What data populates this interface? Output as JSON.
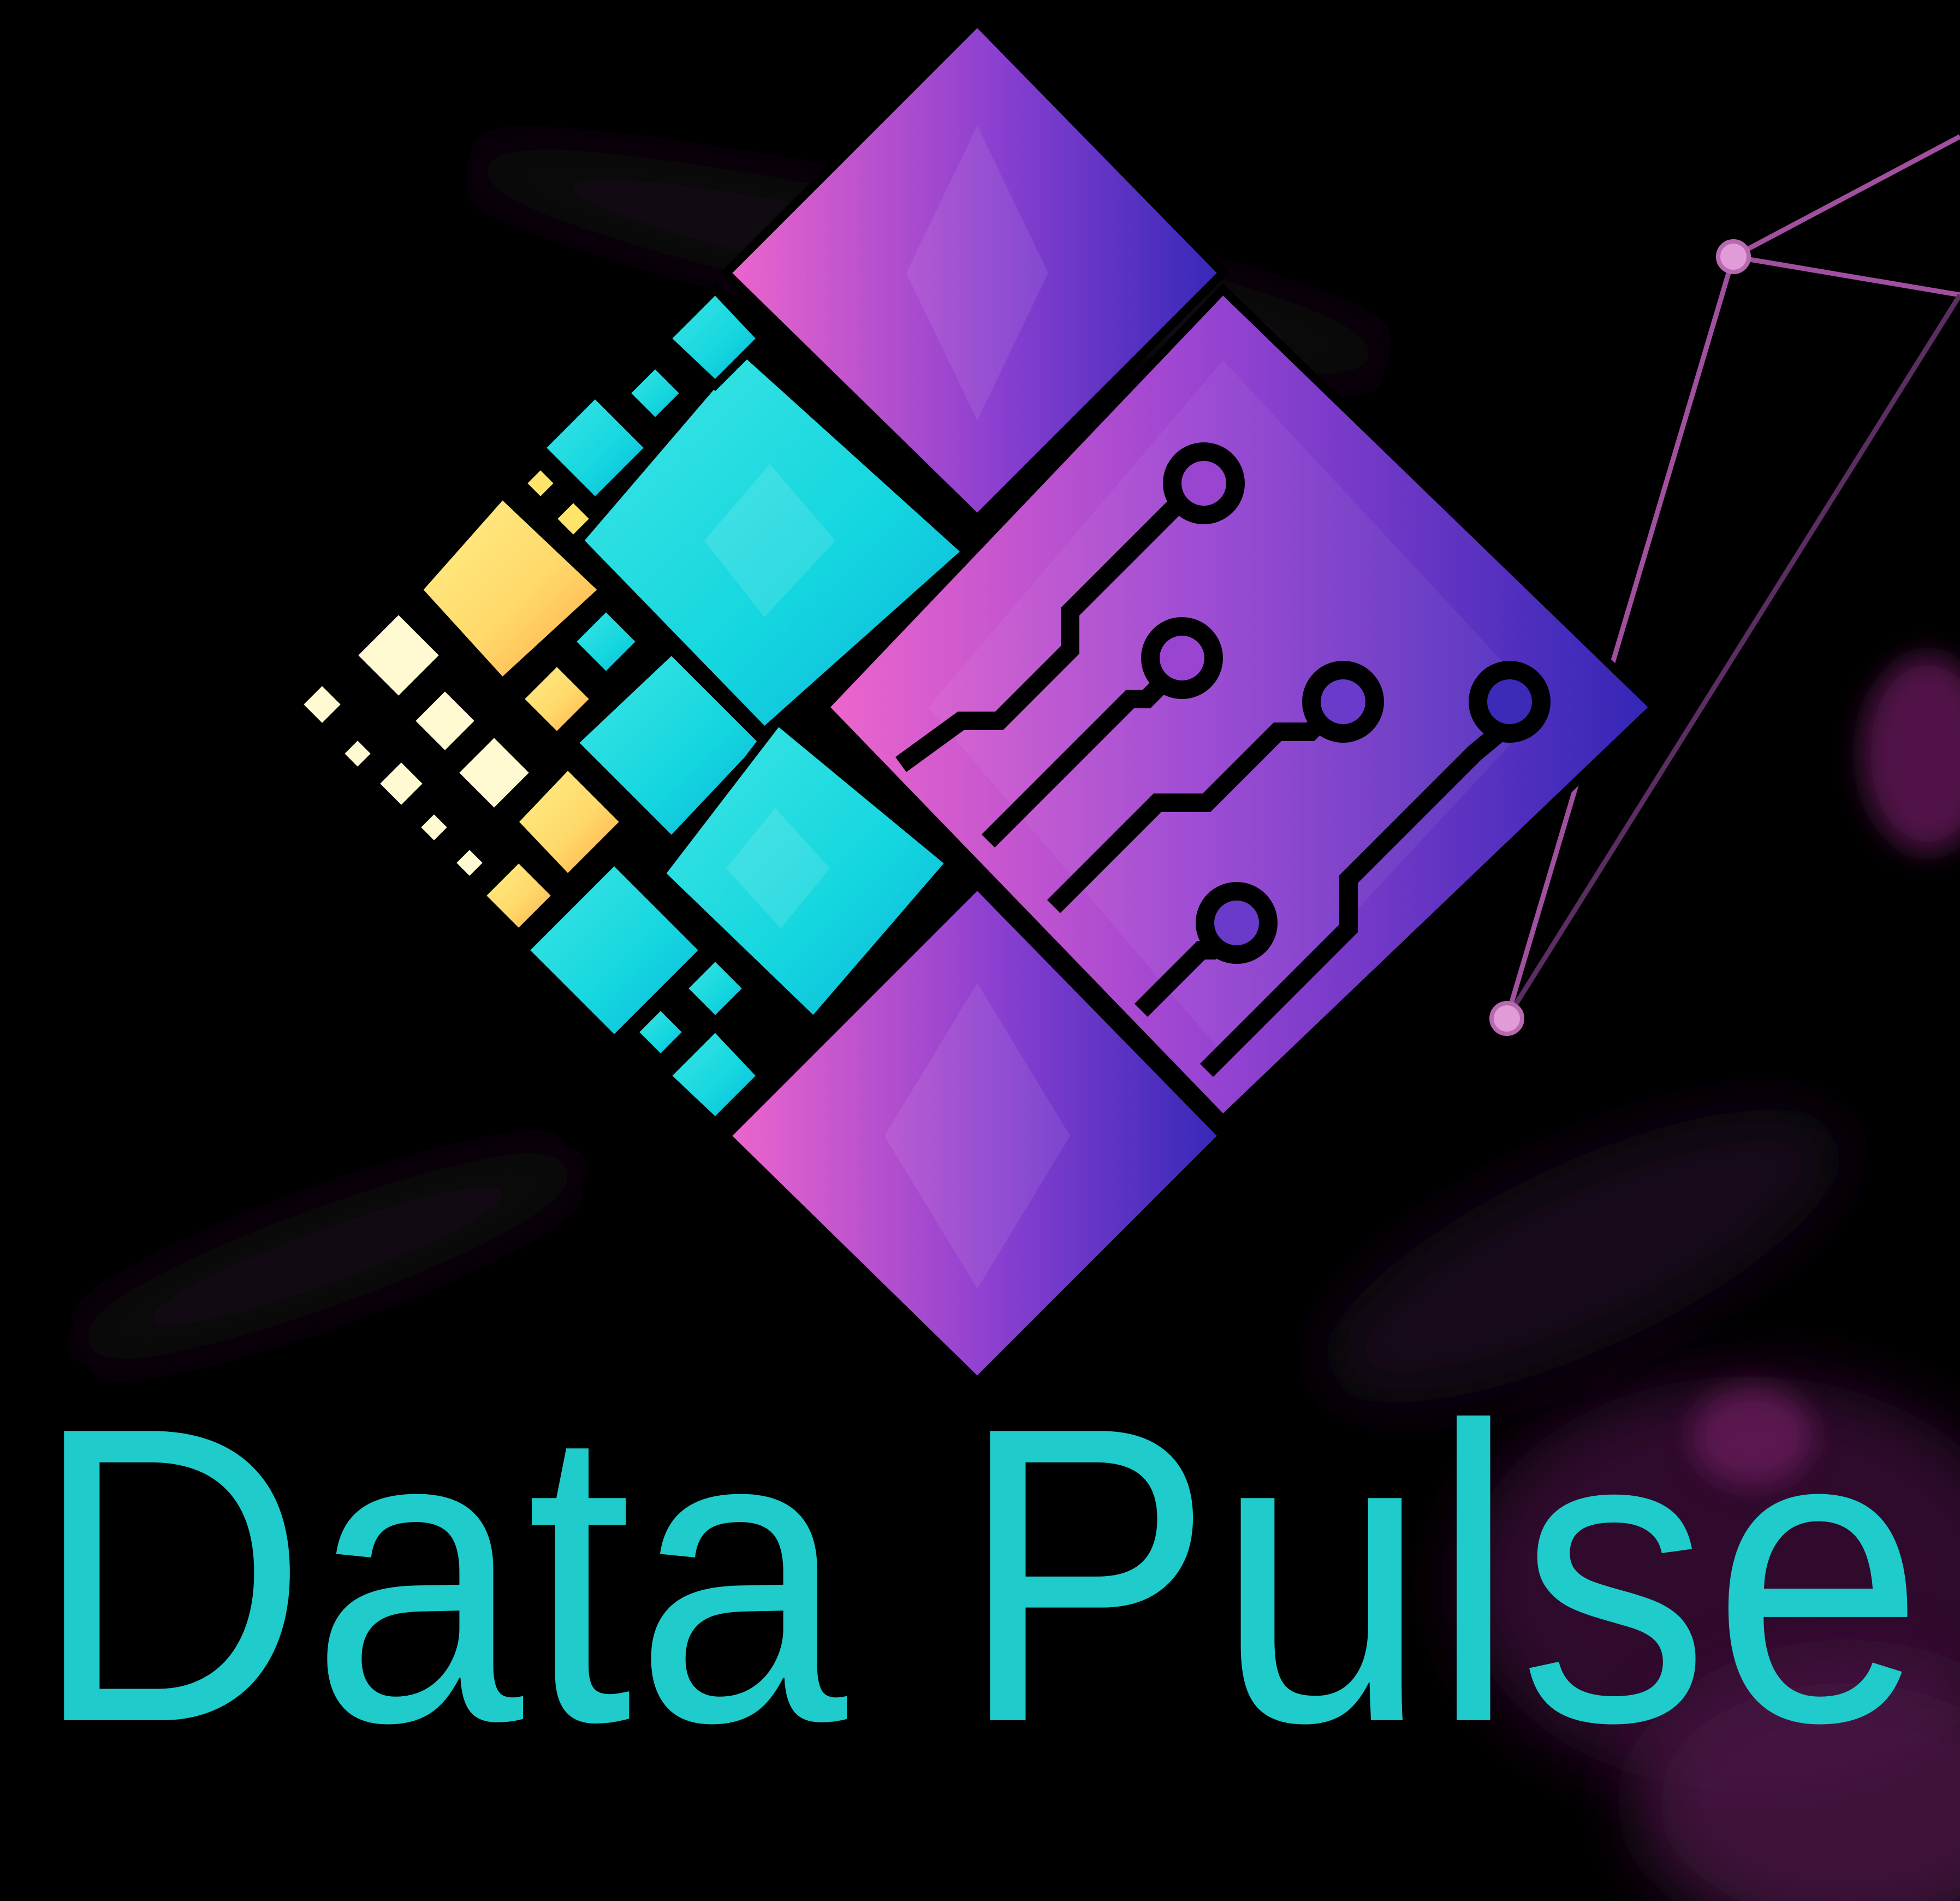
{
  "brand": {
    "name": "Data Pulse",
    "text_color": "#1FCBCB"
  },
  "logo": {
    "icon": "circuit-diamond-logo-icon",
    "colors": {
      "magenta": "#EE66CC",
      "violet": "#8A3FD0",
      "indigo": "#3528B8",
      "cyan": "#14D6DF",
      "cyan_light": "#3FE6E4",
      "yellow": "#FFE46B",
      "orange": "#FFB64A",
      "cream": "#FFFAD2",
      "outline": "#000000"
    }
  },
  "background": {
    "base": "#000000",
    "glow": "#5A1650",
    "network_line": "#A0509E"
  }
}
